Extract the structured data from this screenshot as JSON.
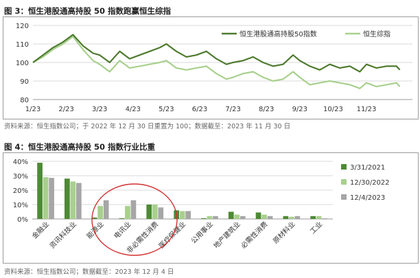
{
  "fig3": {
    "title": "图 3：恒生港股通高持股 50 指数跑赢恒生综指",
    "source": "资料来源：恒生指数公司；于 2022 年 12 月 30 日重置为 100；数据截至：2023 年 11 月 30 日"
  },
  "fig4": {
    "title": "图 4：恒生港股通高持股 50 指数行业比重",
    "source": "资料来源：恒生指数公司；数据截至：2023 年 12 月 4 日"
  },
  "chart_data": [
    {
      "type": "line",
      "title": "",
      "xlabel": "",
      "ylabel": "",
      "ylim": [
        80,
        120
      ],
      "yticks": [
        80,
        90,
        100,
        110,
        120
      ],
      "xticks": [
        "1/23",
        "2/23",
        "3/23",
        "4/23",
        "5/23",
        "6/23",
        "7/23",
        "8/23",
        "9/23",
        "10/23",
        "11/23"
      ],
      "grid": "horizontal",
      "legend": "top-right",
      "x_months": [
        0,
        0.3,
        0.6,
        0.9,
        1.2,
        1.5,
        1.8,
        2.0,
        2.3,
        2.6,
        2.9,
        3.2,
        3.5,
        3.8,
        4.0,
        4.3,
        4.6,
        4.9,
        5.2,
        5.5,
        5.8,
        6.0,
        6.3,
        6.6,
        6.9,
        7.2,
        7.5,
        7.8,
        8.0,
        8.3,
        8.6,
        8.9,
        9.2,
        9.5,
        9.8,
        10.0,
        10.3,
        10.6,
        10.9,
        11.0
      ],
      "series": [
        {
          "name": "恒生港股通高持股50指数",
          "color": "#4e7a2e",
          "values": [
            100,
            104,
            108,
            111,
            115,
            109,
            105,
            104,
            100,
            106,
            102,
            104,
            106,
            108,
            110,
            106,
            103,
            104,
            106,
            102,
            99,
            100,
            101,
            103,
            100,
            98,
            99,
            104,
            101,
            98,
            96,
            99,
            97,
            98,
            95,
            99,
            97,
            98,
            98,
            96
          ]
        },
        {
          "name": "恒生综指",
          "color": "#a8d08d",
          "values": [
            100,
            103,
            107,
            110,
            114,
            107,
            101,
            99,
            95,
            101,
            97,
            98,
            99,
            100,
            101,
            97,
            96,
            97,
            98,
            94,
            91,
            92,
            94,
            95,
            92,
            90,
            91,
            95,
            92,
            88,
            89,
            90,
            89,
            88,
            86,
            89,
            87,
            88,
            89,
            87
          ]
        }
      ]
    },
    {
      "type": "bar",
      "title": "",
      "xlabel": "",
      "ylabel": "",
      "ylim": [
        0,
        40
      ],
      "yticks": [
        "0%",
        "10%",
        "20%",
        "30%",
        "40%"
      ],
      "grid": "horizontal",
      "legend": "right",
      "categories": [
        "金融业",
        "资讯科技业",
        "能源业",
        "电讯业",
        "非必需性消费",
        "医疗保健业",
        "公用事业",
        "地产建筑业",
        "必需性消费",
        "原材料业",
        "工业"
      ],
      "series": [
        {
          "name": "3/31/2021",
          "color": "#4e8a35",
          "values": [
            39,
            28,
            1,
            0.5,
            10,
            6,
            0.5,
            5,
            4.5,
            2,
            2
          ]
        },
        {
          "name": "12/30/2022",
          "color": "#a8d08d",
          "values": [
            29,
            26,
            9,
            9,
            10,
            5.5,
            2,
            3,
            3,
            1.5,
            2
          ]
        },
        {
          "name": "12/4/2023",
          "color": "#a6a6a6",
          "values": [
            28.5,
            25,
            13,
            13,
            8,
            5.5,
            2,
            2,
            2,
            2,
            0.5
          ]
        }
      ]
    }
  ]
}
